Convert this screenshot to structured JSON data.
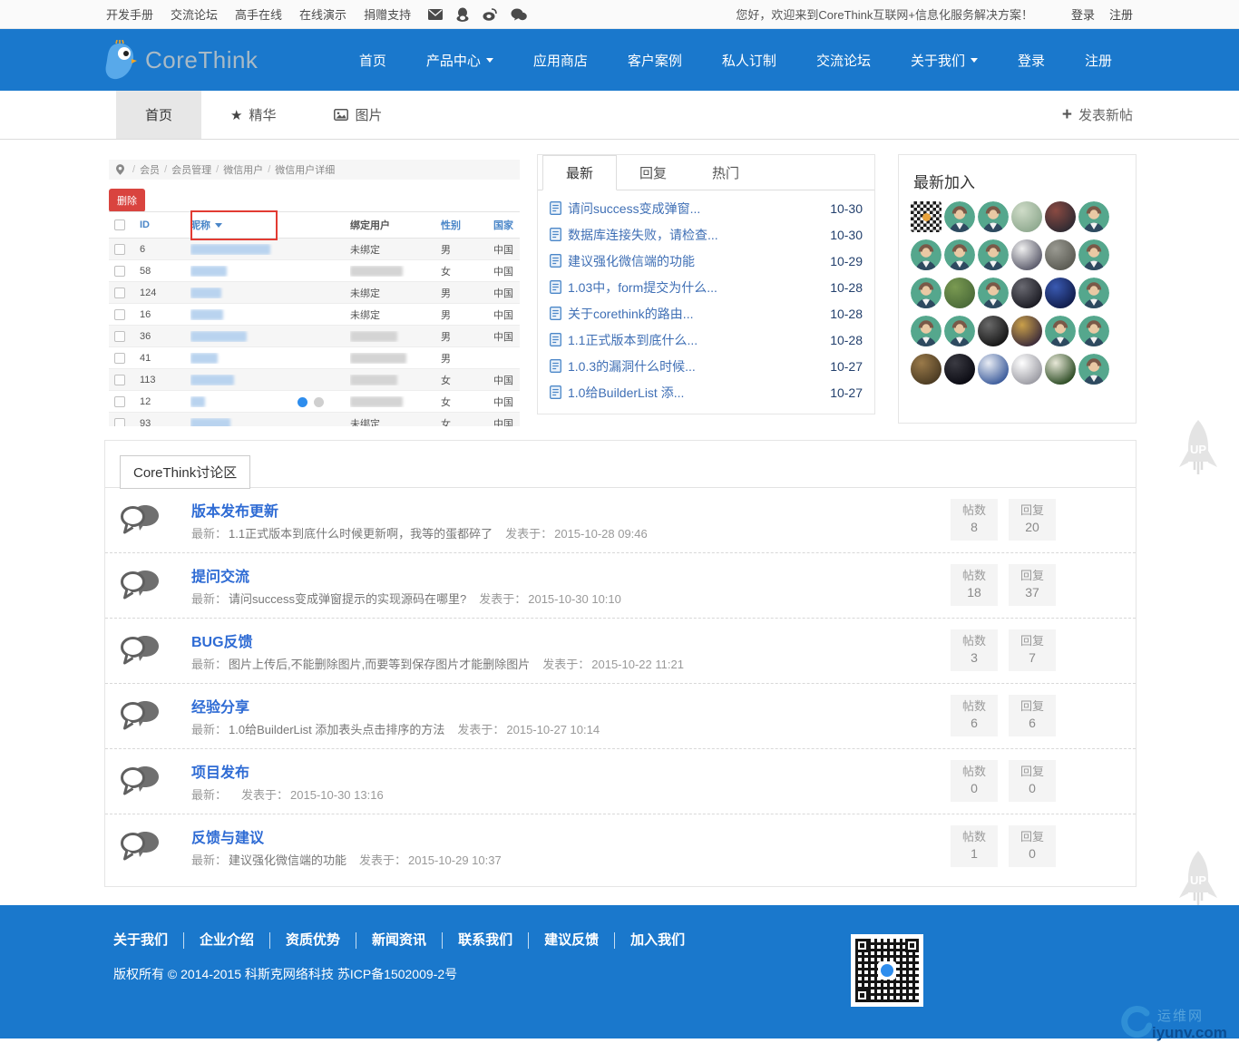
{
  "topbar": {
    "links": [
      "开发手册",
      "交流论坛",
      "高手在线",
      "在线演示",
      "捐赠支持"
    ],
    "icons": [
      "mail-icon",
      "qq-icon",
      "weibo-icon",
      "wechat-icon"
    ],
    "welcome": "您好，欢迎来到CoreThink互联网+信息化服务解决方案！",
    "login": "登录",
    "register": "注册"
  },
  "navbar": {
    "brand": "CoreThink",
    "items": [
      {
        "label": "首页",
        "dropdown": false
      },
      {
        "label": "产品中心",
        "dropdown": true
      },
      {
        "label": "应用商店",
        "dropdown": false
      },
      {
        "label": "客户案例",
        "dropdown": false
      },
      {
        "label": "私人订制",
        "dropdown": false
      },
      {
        "label": "交流论坛",
        "dropdown": false
      },
      {
        "label": "关于我们",
        "dropdown": true
      },
      {
        "label": "登录",
        "dropdown": false
      },
      {
        "label": "注册",
        "dropdown": false
      }
    ]
  },
  "subnav": {
    "tabs": [
      {
        "label": "首页",
        "icon": "",
        "active": true
      },
      {
        "label": "精华",
        "icon": "star-icon",
        "active": false
      },
      {
        "label": "图片",
        "icon": "image-icon",
        "active": false
      }
    ],
    "new_post_label": "发表新帖"
  },
  "carousel": {
    "breadcrumb": [
      "会员",
      "会员管理",
      "微信用户",
      "微信用户详细"
    ],
    "delete_label": "删除",
    "table": {
      "headers": [
        {
          "label": "ID",
          "link": true,
          "caret": false
        },
        {
          "label": "昵称",
          "link": true,
          "caret": true,
          "highlighted": true
        },
        {
          "label": "绑定用户",
          "link": false,
          "caret": false
        },
        {
          "label": "性别",
          "link": true,
          "caret": false
        },
        {
          "label": "国家",
          "link": true,
          "caret": false
        }
      ],
      "rows": [
        {
          "id": "6",
          "nick_blur": 88,
          "bind": "未绑定",
          "bind_blur": 0,
          "gender": "男",
          "country": "中国"
        },
        {
          "id": "58",
          "nick_blur": 40,
          "bind": "",
          "bind_blur": 58,
          "gender": "女",
          "country": "中国"
        },
        {
          "id": "124",
          "nick_blur": 34,
          "bind": "未绑定",
          "bind_blur": 0,
          "gender": "男",
          "country": "中国"
        },
        {
          "id": "16",
          "nick_blur": 36,
          "bind": "未绑定",
          "bind_blur": 0,
          "gender": "男",
          "country": "中国"
        },
        {
          "id": "36",
          "nick_blur": 62,
          "bind": "",
          "bind_blur": 52,
          "gender": "男",
          "country": "中国"
        },
        {
          "id": "41",
          "nick_blur": 30,
          "bind": "",
          "bind_blur": 62,
          "gender": "男",
          "country": ""
        },
        {
          "id": "113",
          "nick_blur": 48,
          "bind": "",
          "bind_blur": 52,
          "gender": "女",
          "country": "中国"
        },
        {
          "id": "12",
          "nick_blur": 16,
          "bind": "",
          "bind_blur": 58,
          "gender": "女",
          "country": "中国"
        },
        {
          "id": "93",
          "nick_blur": 44,
          "bind": "未绑定",
          "bind_blur": 0,
          "gender": "女",
          "country": "中国"
        }
      ]
    },
    "dots": [
      "active",
      "inactive"
    ]
  },
  "posts_panel": {
    "tabs": [
      {
        "label": "最新",
        "active": true
      },
      {
        "label": "回复",
        "active": false
      },
      {
        "label": "热门",
        "active": false
      }
    ],
    "posts": [
      {
        "title": "请问success变成弹窗...",
        "date": "10-30"
      },
      {
        "title": "数据库连接失败，请检查...",
        "date": "10-30"
      },
      {
        "title": "建议强化微信端的功能",
        "date": "10-29"
      },
      {
        "title": "1.03中，form提交为什么...",
        "date": "10-28"
      },
      {
        "title": "关于corethink的路由...",
        "date": "10-28"
      },
      {
        "title": "1.1正式版本到底什么...",
        "date": "10-28"
      },
      {
        "title": "1.0.3的漏洞什么时候...",
        "date": "10-27"
      },
      {
        "title": "1.0给BuilderList 添...",
        "date": "10-27"
      }
    ]
  },
  "members_panel": {
    "title": "最新加入",
    "avatars": [
      {
        "type": "qr"
      },
      {
        "type": "default"
      },
      {
        "type": "default"
      },
      {
        "type": "photo",
        "c1": "#cfdcc8",
        "c2": "#8fa98f"
      },
      {
        "type": "photo",
        "c1": "#8a4a42",
        "c2": "#2e2a32"
      },
      {
        "type": "default"
      },
      {
        "type": "default"
      },
      {
        "type": "default"
      },
      {
        "type": "default"
      },
      {
        "type": "photo",
        "c1": "#f0f0f0",
        "c2": "#5a5a6a"
      },
      {
        "type": "photo",
        "c1": "#9a9a92",
        "c2": "#5a5a52"
      },
      {
        "type": "default"
      },
      {
        "type": "default"
      },
      {
        "type": "photo",
        "c1": "#7a9a52",
        "c2": "#4a6a38"
      },
      {
        "type": "default"
      },
      {
        "type": "photo",
        "c1": "#6a6a72",
        "c2": "#1a1a22"
      },
      {
        "type": "photo",
        "c1": "#3a5ab2",
        "c2": "#101c4a"
      },
      {
        "type": "default"
      },
      {
        "type": "default"
      },
      {
        "type": "default"
      },
      {
        "type": "photo",
        "c1": "#6a6a6a",
        "c2": "#141414"
      },
      {
        "type": "photo",
        "c1": "#caa04a",
        "c2": "#3a2a3a"
      },
      {
        "type": "default"
      },
      {
        "type": "default"
      },
      {
        "type": "photo",
        "c1": "#9a7a4a",
        "c2": "#4a3a22"
      },
      {
        "type": "photo",
        "c1": "#3a3a42",
        "c2": "#0a0a12"
      },
      {
        "type": "photo",
        "c1": "#e8ecf4",
        "c2": "#3a5a9a"
      },
      {
        "type": "photo",
        "c1": "#ffffff",
        "c2": "#9a9aa2"
      },
      {
        "type": "photo",
        "c1": "#e8e8d8",
        "c2": "#2a4a22"
      },
      {
        "type": "default"
      }
    ]
  },
  "forum": {
    "title": "CoreThink讨论区",
    "latest_label": "最新：",
    "posted_label": "发表于：",
    "posts_label": "帖数",
    "replies_label": "回复",
    "sections": [
      {
        "name": "版本发布更新",
        "latest": "1.1正式版本到底什么时候更新啊，我等的蛋都碎了",
        "posted": "2015-10-28 09:46",
        "posts": 8,
        "replies": 20
      },
      {
        "name": "提问交流",
        "latest": "请问success变成弹窗提示的实现源码在哪里?",
        "posted": "2015-10-30 10:10",
        "posts": 18,
        "replies": 37
      },
      {
        "name": "BUG反馈",
        "latest": "图片上传后,不能删除图片,而要等到保存图片才能删除图片",
        "posted": "2015-10-22 11:21",
        "posts": 3,
        "replies": 7
      },
      {
        "name": "经验分享",
        "latest": "1.0给BuilderList 添加表头点击排序的方法",
        "posted": "2015-10-27 10:14",
        "posts": 6,
        "replies": 6
      },
      {
        "name": "项目发布",
        "latest": "",
        "posted": "2015-10-30 13:16",
        "posts": 0,
        "replies": 0
      },
      {
        "name": "反馈与建议",
        "latest": "建议强化微信端的功能",
        "posted": "2015-10-29 10:37",
        "posts": 1,
        "replies": 0
      }
    ]
  },
  "footer": {
    "links": [
      "关于我们",
      "企业介绍",
      "资质优势",
      "新闻资讯",
      "联系我们",
      "建议反馈",
      "加入我们"
    ],
    "copyright": "版权所有 © 2014-2015 科斯克网络科技 苏ICP备1502009-2号"
  },
  "floating": {
    "up_label": "UP",
    "watermark_site": "运维网",
    "watermark_domain": "iyunv.com"
  },
  "colors": {
    "brand_blue": "#1a78cc",
    "link_blue": "#3f6fb5",
    "section_title_blue": "#2e6bd4",
    "danger_red": "#d9443f",
    "avatar_teal": "#55a78d",
    "active_dot_blue": "#2e8ded"
  }
}
